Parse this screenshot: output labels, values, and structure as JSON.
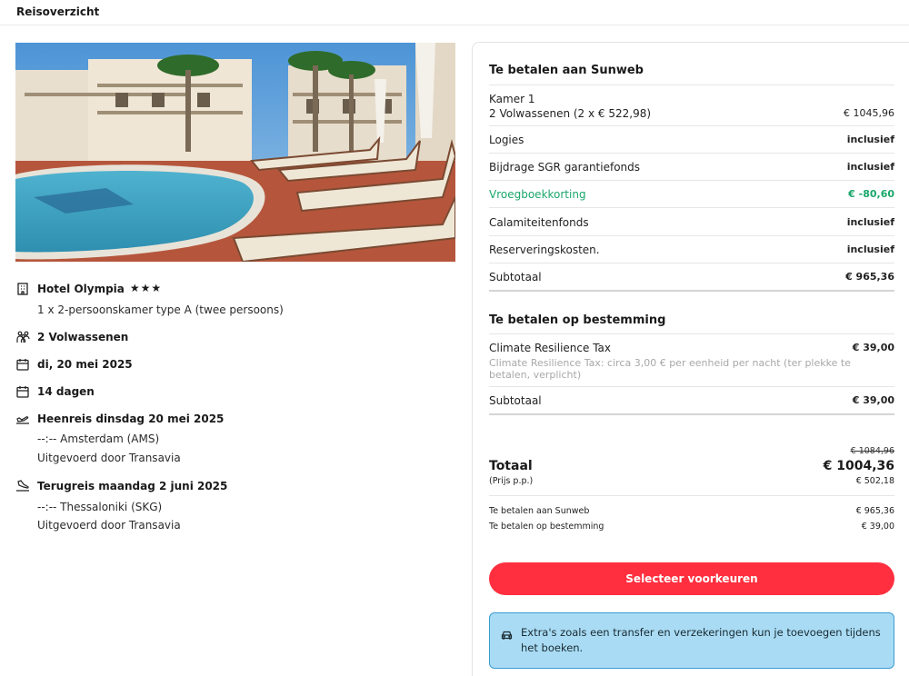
{
  "header": {
    "title": "Reisoverzicht"
  },
  "hotel": {
    "name": "Hotel Olympia",
    "stars": "★★★",
    "room": "1 x 2-persoonskamer type A (twee persoons)",
    "guests": "2 Volwassenen",
    "date": "di, 20 mei 2025",
    "duration": "14 dagen",
    "outbound": {
      "title": "Heenreis dinsdag 20 mei 2025",
      "route": "--:-- Amsterdam (AMS)",
      "carrier": "Uitgevoerd door Transavia"
    },
    "return": {
      "title": "Terugreis maandag 2 juni 2025",
      "route": "--:-- Thessaloniki (SKG)",
      "carrier": "Uitgevoerd door Transavia"
    }
  },
  "sunweb": {
    "title": "Te betalen aan Sunweb",
    "room_label": "Kamer 1",
    "room_detail": "2 Volwassenen (2 x € 522,98)",
    "room_price": "€ 1045,96",
    "rows": [
      {
        "label": "Logies",
        "value": "inclusief"
      },
      {
        "label": "Bijdrage SGR garantiefonds",
        "value": "inclusief"
      },
      {
        "label": "Vroegboekkorting",
        "value": "€ -80,60"
      },
      {
        "label": "Calamiteitenfonds",
        "value": "inclusief"
      },
      {
        "label": "Reserveringskosten.",
        "value": "inclusief"
      }
    ],
    "subtotal_label": "Subtotaal",
    "subtotal_value": "€ 965,36"
  },
  "destination": {
    "title": "Te betalen op bestemming",
    "tax_label": "Climate Resilience Tax",
    "tax_value": "€ 39,00",
    "tax_note": "Climate Resilience Tax: circa 3,00 € per eenheid per nacht (ter plekke te betalen, verplicht)",
    "subtotal_label": "Subtotaal",
    "subtotal_value": "€ 39,00"
  },
  "total": {
    "old_price": "€ 1084,96",
    "label": "Totaal",
    "value": "€ 1004,36",
    "pp_label": "(Prijs p.p.)",
    "pp_value": "€ 502,18",
    "sunweb_label": "Te betalen aan Sunweb",
    "sunweb_value": "€ 965,36",
    "dest_label": "Te betalen op bestemming",
    "dest_value": "€ 39,00"
  },
  "cta": {
    "label": "Selecteer voorkeuren"
  },
  "info": {
    "message": "Extra's zoals een transfer en verzekeringen kun je toevoegen tijdens het boeken."
  },
  "colors": {
    "accent": "#ff2f3f",
    "discount": "#1aa76b",
    "info_bg": "#a9dcf4",
    "info_border": "#3a9bd1"
  },
  "icons": [
    "hotel-icon",
    "people-icon",
    "calendar-icon",
    "plane-departure-icon",
    "plane-arrival-icon",
    "car-icon"
  ]
}
